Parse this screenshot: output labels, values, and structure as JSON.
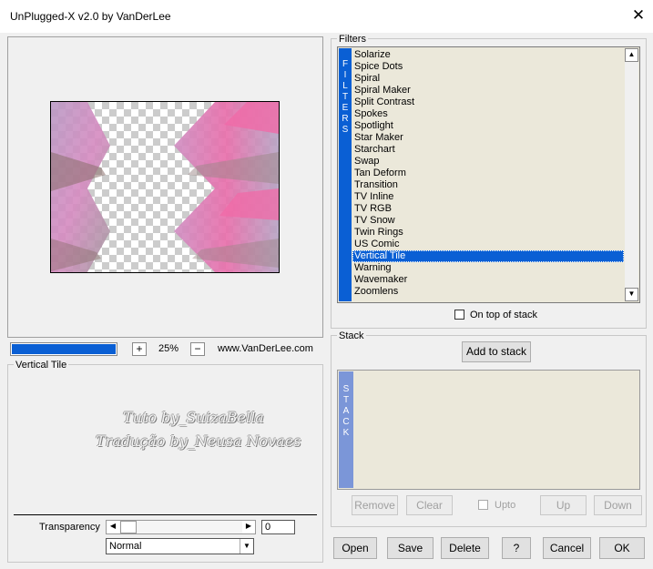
{
  "window": {
    "title": "UnPlugged-X v2.0 by VanDerLee",
    "close_glyph": "✕"
  },
  "preview": {
    "zoom_plus": "+",
    "zoom_minus": "−",
    "zoom_level": "25%",
    "website": "www.VanDerLee.com"
  },
  "filter_settings": {
    "group_label": "Vertical Tile",
    "watermark_line1": "Tuto by_SuizaBella",
    "watermark_line2": "Tradução by_Neusa Novaes",
    "transparency_label": "Transparency",
    "transparency_value": "0",
    "blend_mode": "Normal"
  },
  "filters": {
    "group_label": "Filters",
    "strip_letters": [
      "F",
      "I",
      "L",
      "T",
      "E",
      "R",
      "S"
    ],
    "items": [
      "Solarize",
      "Spice Dots",
      "Spiral",
      "Spiral Maker",
      "Split Contrast",
      "Spokes",
      "Spotlight",
      "Star Maker",
      "Starchart",
      "Swap",
      "Tan Deform",
      "Transition",
      "TV Inline",
      "TV RGB",
      "TV Snow",
      "Twin Rings",
      "US Comic",
      "Vertical Tile",
      "Warning",
      "Wavemaker",
      "Zoomlens"
    ],
    "selected": "Vertical Tile",
    "on_top_label": "On top of stack"
  },
  "stack": {
    "group_label": "Stack",
    "add_button": "Add to stack",
    "strip_letters": [
      "S",
      "T",
      "A",
      "C",
      "K"
    ],
    "remove": "Remove",
    "clear": "Clear",
    "upto": "Upto",
    "up": "Up",
    "down": "Down"
  },
  "footer": {
    "open": "Open",
    "save": "Save",
    "delete": "Delete",
    "help": "?",
    "cancel": "Cancel",
    "ok": "OK"
  },
  "colors": {
    "accent": "#0a5fd4",
    "stack_strip": "#7b96d8",
    "list_bg": "#ebe8da"
  }
}
